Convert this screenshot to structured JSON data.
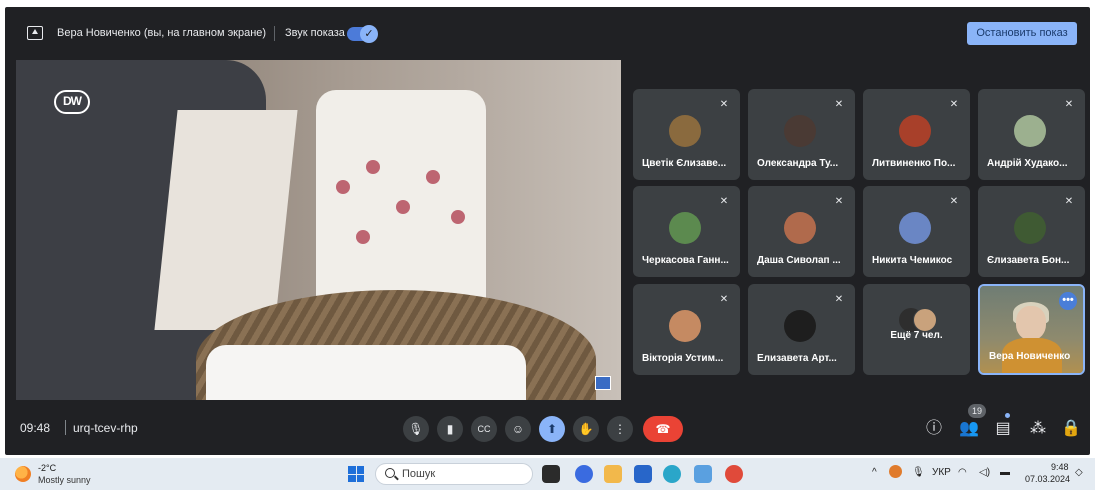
{
  "meet": {
    "presenter_label": "Вера Новиченко (вы, на главном экране)",
    "sound_label": "Звук показа",
    "sound_toggle_glyph": "✓",
    "stop_button_label": "Остановить показ",
    "main_video": {
      "logo_text": "DW"
    },
    "tiles": [
      {
        "name": "Цветік Єлизаве...",
        "avatar_color": "#8a6a3e"
      },
      {
        "name": "Олександра Ту...",
        "avatar_color": "#4a3a34"
      },
      {
        "name": "Литвиненко По...",
        "avatar_color": "#a8402a"
      },
      {
        "name": "Андрій Худако...",
        "avatar_color": "#9cb08f"
      },
      {
        "name": "Черкасова Ганн...",
        "avatar_color": "#5c8a4f"
      },
      {
        "name": "Даша Сиволап ...",
        "avatar_color": "#b06a4c"
      },
      {
        "name": "Никита Чемикос",
        "avatar_color": "#6a86c4"
      },
      {
        "name": "Єлизавета Бон...",
        "avatar_color": "#3f5a33"
      },
      {
        "name": "Вікторія Устим...",
        "avatar_color": "#c58a62"
      },
      {
        "name": "Елизавета Арт...",
        "avatar_color": "#1e1e1e"
      }
    ],
    "more_tile": {
      "label": "Ещё 7 чел."
    },
    "self_tile": {
      "name": "Вера Новиченко",
      "more_glyph": "•••"
    },
    "bottom_bar": {
      "time": "09:48",
      "meeting_code": "urq-tcev-rhp",
      "controls": [
        {
          "name": "mic-icon",
          "glyph": "🎙"
        },
        {
          "name": "camera-icon",
          "glyph": "▮"
        },
        {
          "name": "captions-icon",
          "glyph": "CC"
        },
        {
          "name": "emoji-icon",
          "glyph": "☺"
        },
        {
          "name": "present-icon",
          "glyph": "⬆"
        },
        {
          "name": "raise-hand-icon",
          "glyph": "✋"
        },
        {
          "name": "more-options-icon",
          "glyph": "⋮"
        },
        {
          "name": "hang-up-icon",
          "glyph": "☎"
        }
      ],
      "right_controls": [
        {
          "name": "info-icon",
          "glyph": "ⓘ"
        },
        {
          "name": "people-icon",
          "glyph": "👥"
        },
        {
          "name": "chat-icon",
          "glyph": "▤"
        },
        {
          "name": "activities-icon",
          "glyph": "⁂"
        },
        {
          "name": "host-controls-icon",
          "glyph": "🔒"
        }
      ],
      "people_count": "19"
    },
    "colors": {
      "background": "#202124",
      "tile": "#3c4043",
      "accent": "#8ab4f8",
      "hangup": "#ea4335"
    }
  },
  "taskbar": {
    "weather_temp": "-2°C",
    "weather_desc": "Mostly sunny",
    "search_placeholder": "Пошук",
    "apps": [
      {
        "name": "file-explorer-icon",
        "color": "#2b2b2b"
      },
      {
        "name": "meet-app-icon",
        "color": "#3a6be0"
      },
      {
        "name": "folder-icon",
        "color": "#f2b84b"
      },
      {
        "name": "store-icon",
        "color": "#2866c9"
      },
      {
        "name": "edge-icon",
        "color": "#2aa6c9"
      },
      {
        "name": "notepad-icon",
        "color": "#5aa0e0"
      },
      {
        "name": "chrome-icon",
        "color": "#e04a3a"
      }
    ],
    "lang": "УКР",
    "tray_arrow": "^",
    "time": "9:48",
    "date": "07.03.2024"
  }
}
